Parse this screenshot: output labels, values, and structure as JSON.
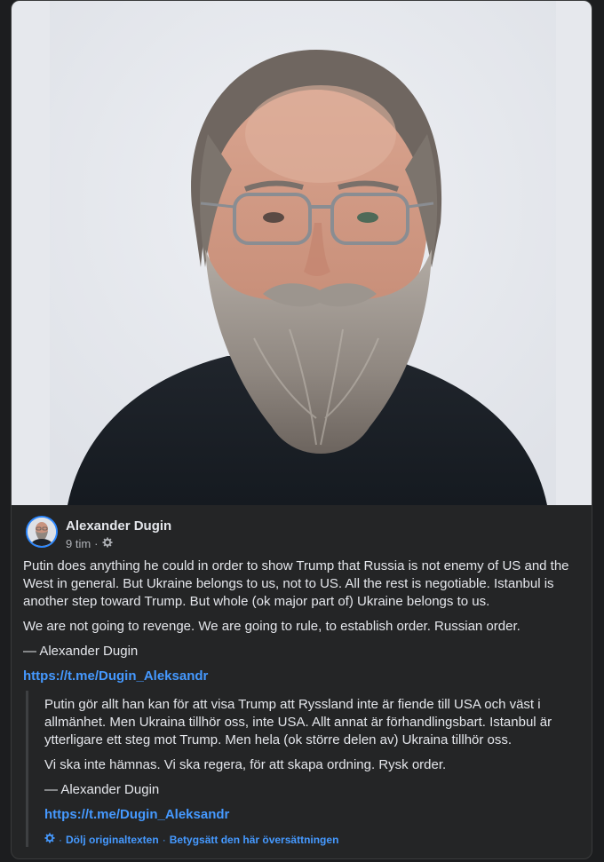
{
  "post": {
    "author": "Alexander Dugin",
    "time": "9 tim",
    "meta_separator": "·",
    "privacy_icon": "gear-icon",
    "paragraphs": [
      "Putin does anything he could in order to show Trump that Russia is not enemy of US and the West in general. But Ukraine belongs to us, not to US. All the rest is negotiable. Istanbul is another step toward Trump. But whole (ok major part of) Ukraine belongs to us.",
      "We are not going to revenge. We are going to rule, to establish order. Russian order.",
      "— Alexander Dugin"
    ],
    "link": "https://t.me/Dugin_Aleksandr"
  },
  "translation": {
    "paragraphs": [
      "Putin gör allt han kan för att visa Trump att Ryssland inte är fiende till USA och väst i allmänhet. Men Ukraina tillhör oss, inte USA. Allt annat är förhandlingsbart. Istanbul är ytterligare ett steg mot Trump. Men hela (ok större delen av) Ukraina tillhör oss.",
      "Vi ska inte hämnas. Vi ska regera, för att skapa ordning. Rysk order.",
      "— Alexander Dugin"
    ],
    "link": "https://t.me/Dugin_Aleksandr",
    "hide_original": "Dölj originaltexten",
    "rate": "Betygsätt den här översättningen",
    "separator": "·",
    "settings_icon": "gear-icon"
  },
  "colors": {
    "background": "#242526",
    "text": "#e4e6eb",
    "secondary_text": "#b0b3b8",
    "link": "#4599ff",
    "avatar_ring": "#2d88ff"
  }
}
